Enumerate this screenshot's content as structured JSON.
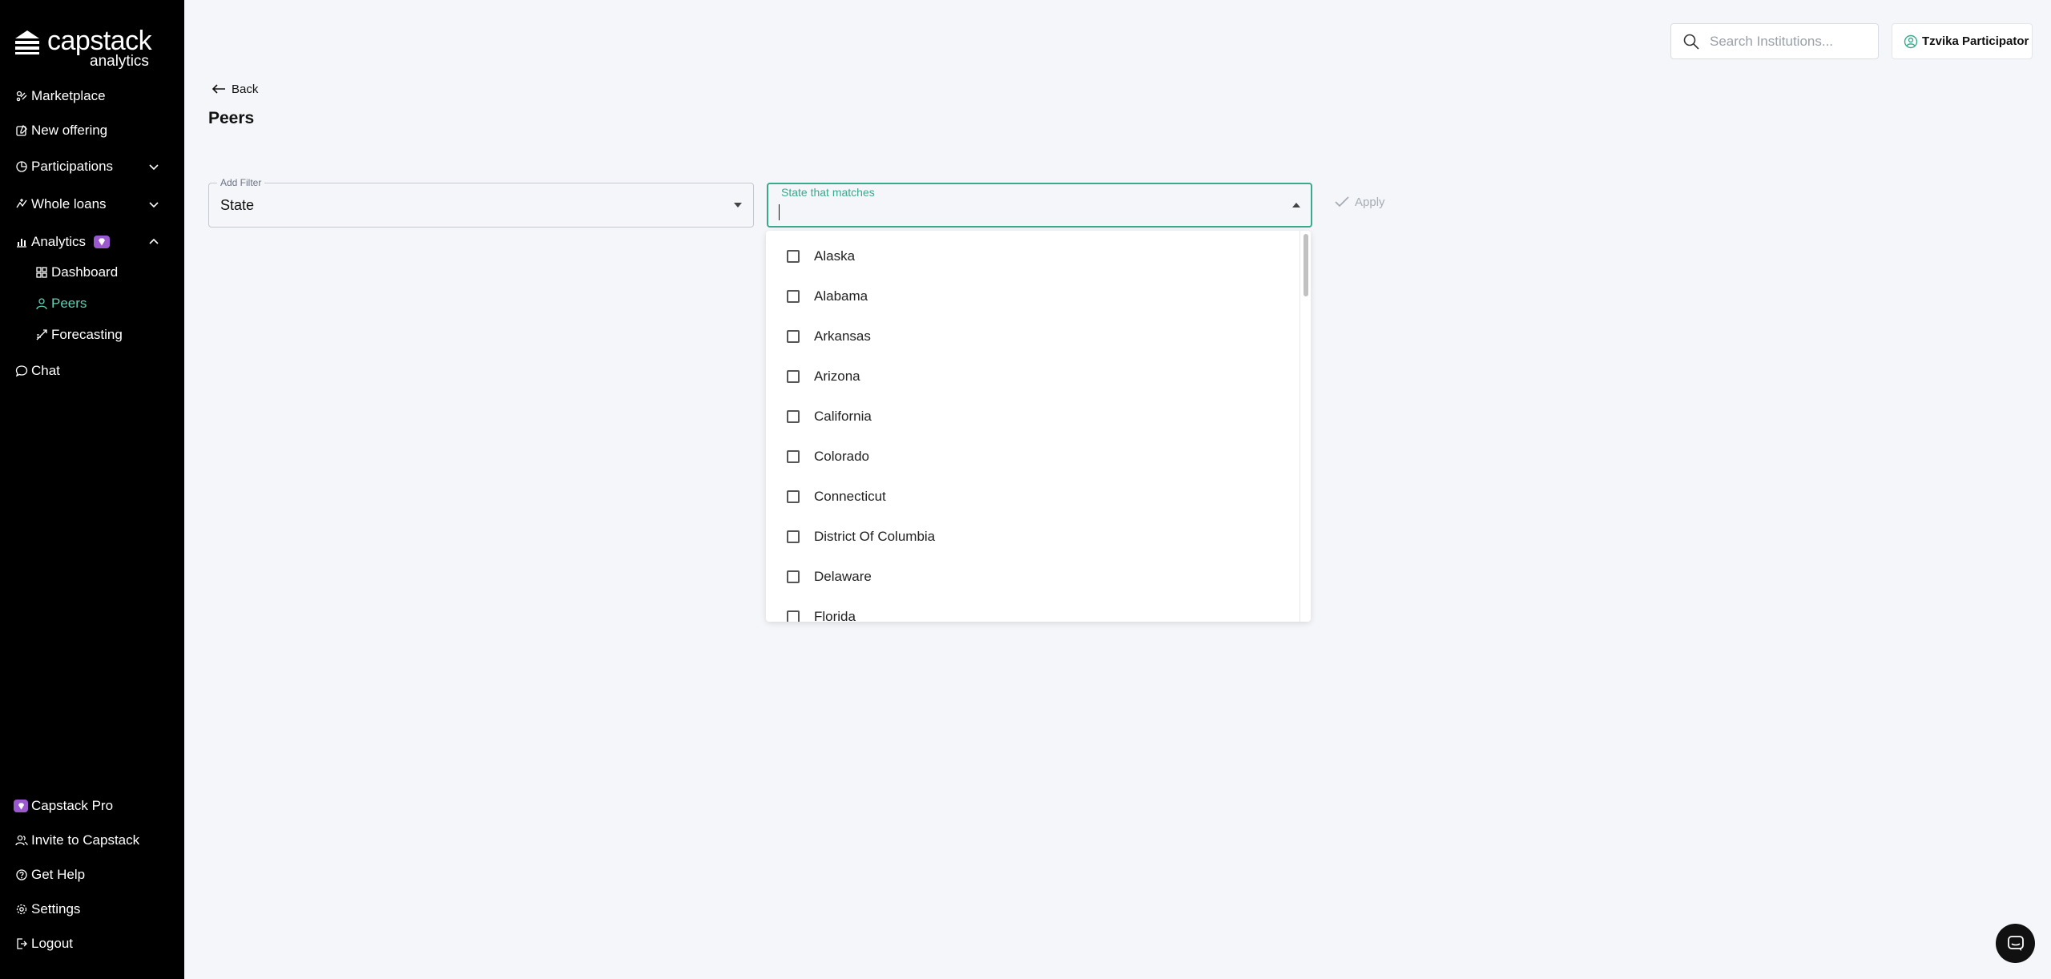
{
  "brand": {
    "name": "capstack",
    "sub": "analytics"
  },
  "sidebar": {
    "nav": [
      {
        "label": "Marketplace"
      },
      {
        "label": "New offering"
      },
      {
        "label": "Participations"
      },
      {
        "label": "Whole loans"
      },
      {
        "label": "Analytics"
      },
      {
        "label": "Dashboard"
      },
      {
        "label": "Peers"
      },
      {
        "label": "Forecasting"
      },
      {
        "label": "Chat"
      }
    ],
    "bottom": [
      {
        "label": "Capstack Pro"
      },
      {
        "label": "Invite to Capstack"
      },
      {
        "label": "Get Help"
      },
      {
        "label": "Settings"
      },
      {
        "label": "Logout"
      }
    ]
  },
  "topbar": {
    "search_placeholder": "Search Institutions...",
    "user_name": "Tzvika Participator"
  },
  "main": {
    "back_label": "Back",
    "title": "Peers",
    "filter": {
      "legend": "Add Filter",
      "value": "State"
    },
    "state_field": {
      "legend": "State that matches",
      "value": ""
    },
    "apply_label": "Apply",
    "options": [
      "Alaska",
      "Alabama",
      "Arkansas",
      "Arizona",
      "California",
      "Colorado",
      "Connecticut",
      "District Of Columbia",
      "Delaware",
      "Florida"
    ]
  },
  "colors": {
    "accent": "#3aa98e",
    "active_nav": "#5fd0b4",
    "pro": "#9b59d0"
  }
}
